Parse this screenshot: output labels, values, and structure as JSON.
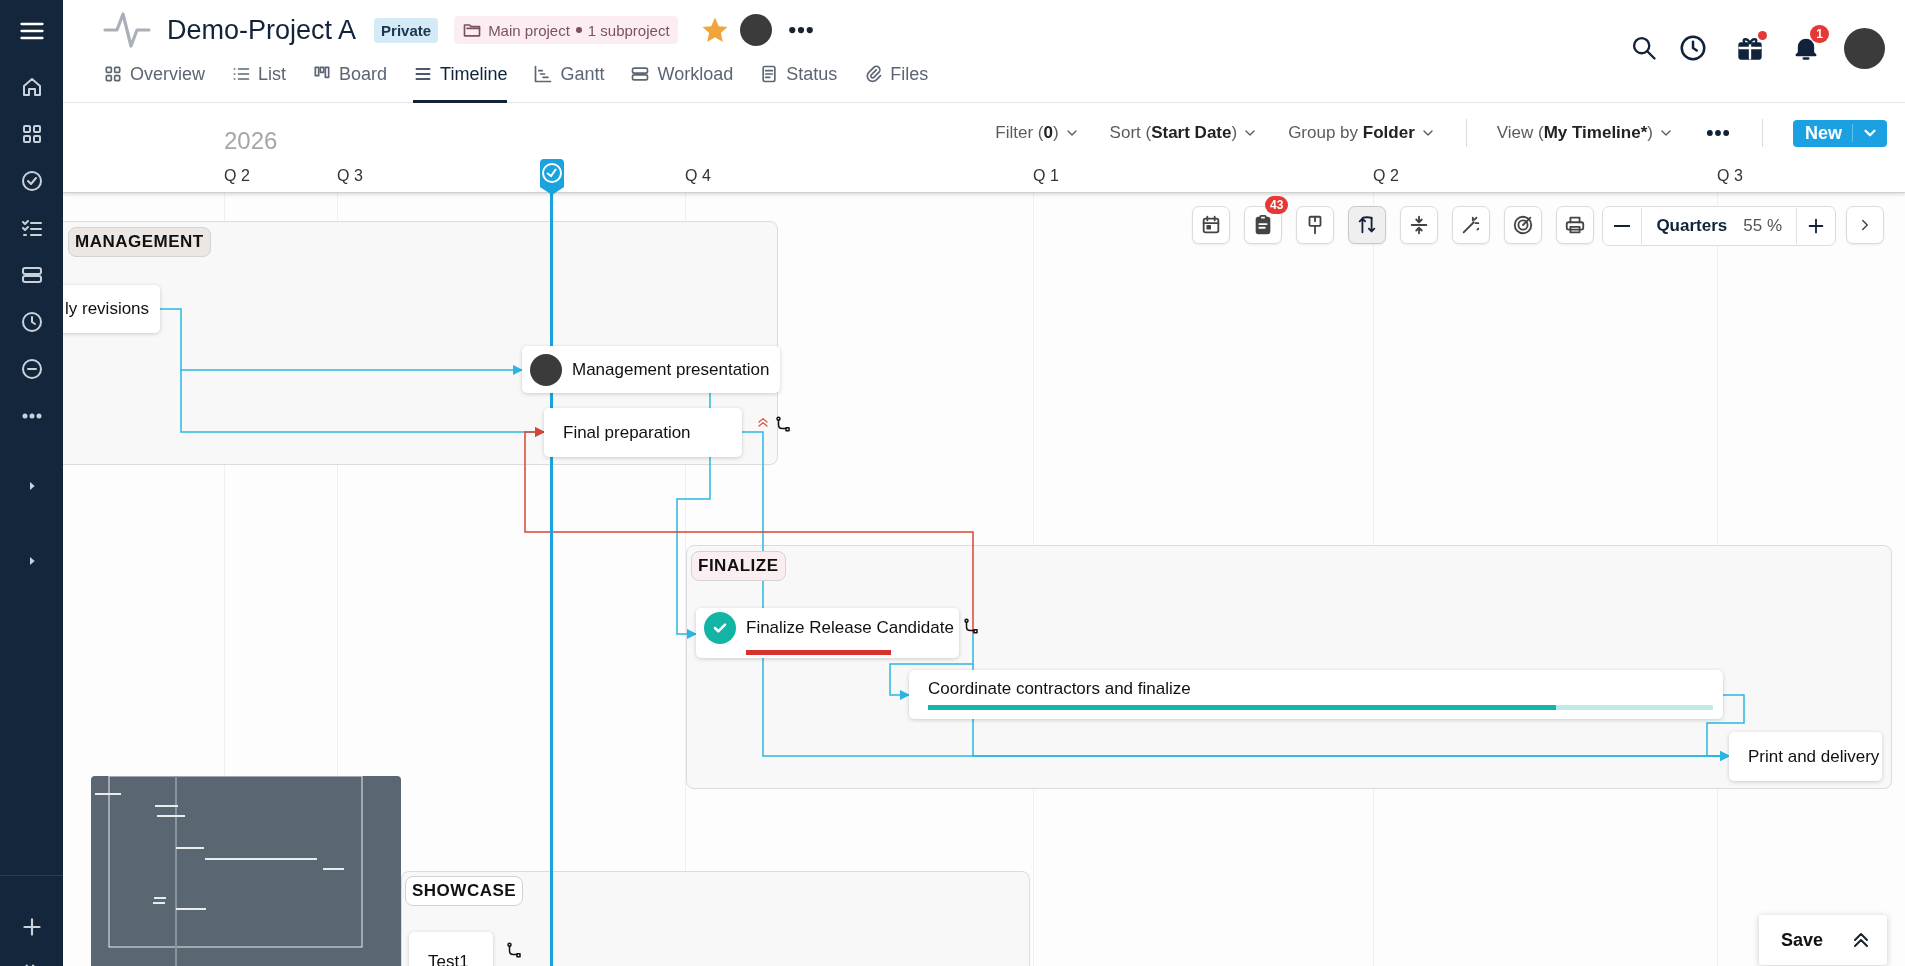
{
  "project": {
    "title": "Demo-Project A",
    "visibility": "Private",
    "folder": "Main project",
    "subprojects": "1 subproject",
    "starred": true
  },
  "tabs": [
    {
      "label": "Overview",
      "selected": false
    },
    {
      "label": "List",
      "selected": false
    },
    {
      "label": "Board",
      "selected": false
    },
    {
      "label": "Timeline",
      "selected": true
    },
    {
      "label": "Gantt",
      "selected": false
    },
    {
      "label": "Workload",
      "selected": false
    },
    {
      "label": "Status",
      "selected": false
    },
    {
      "label": "Files",
      "selected": false
    }
  ],
  "header": {
    "gift_unread": true,
    "notifications": "1"
  },
  "filters": [
    {
      "prefix": "Filter (",
      "value": "0",
      "suffix": ")"
    },
    {
      "prefix": "Sort (",
      "value": "Start Date",
      "suffix": ")"
    },
    {
      "prefix": "Group by ",
      "value": "Folder"
    },
    {
      "prefix": "View (",
      "value": "My Timeline*",
      "suffix": ")"
    }
  ],
  "new_button": "New",
  "timeline": {
    "year": "2026",
    "quarters": [
      "Q 2",
      "Q 3",
      "Q 4",
      "Q 1",
      "Q 2",
      "Q 3"
    ]
  },
  "toolbar": {
    "task_count": "43",
    "dependencies_shown": true,
    "scale": "Quarters",
    "zoom": "55 %"
  },
  "groups": [
    {
      "name": "MANAGEMENT",
      "color": "#ece7e2"
    },
    {
      "name": "FINALIZE",
      "color": "#fbeef1"
    },
    {
      "name": "SHOWCASE",
      "color": "#ffffff"
    }
  ],
  "tasks": [
    {
      "title": "ly revisions"
    },
    {
      "title": "Management presentation",
      "assignee": true
    },
    {
      "title": "Final preparation",
      "high_priority": true,
      "dependency_link": true
    },
    {
      "title": "Finalize Release Candidate",
      "done": true,
      "level": 1,
      "overdue": true,
      "dependency_link": true
    },
    {
      "title": "Coordinate contractors and finalize",
      "level": 0.8,
      "overdue": false
    },
    {
      "title": "Print and delivery"
    },
    {
      "title": "Test1",
      "dependency_link": true
    }
  ],
  "save_button": "Save"
}
